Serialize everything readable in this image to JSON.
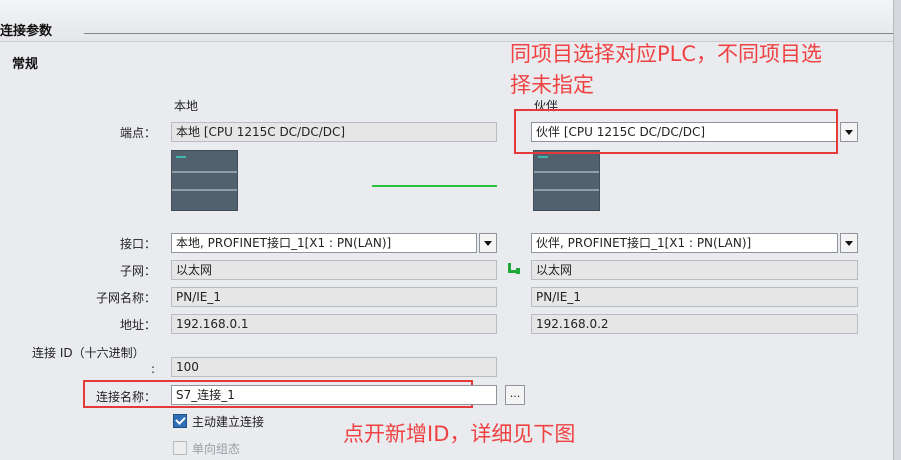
{
  "section": {
    "title": "连接参数"
  },
  "group": {
    "title": "常规"
  },
  "columns": {
    "local": "本地",
    "partner": "伙伴"
  },
  "labels": {
    "endpoint": "端点：",
    "interface": "接口：",
    "subnet": "子网：",
    "subnet_name": "子网名称：",
    "address": "地址：",
    "connection_id_line1": "连接 ID（十六进制）",
    "connection_id_line2": ":",
    "connection_name": "连接名称："
  },
  "local": {
    "endpoint": "本地 [CPU 1215C DC/DC/DC]",
    "interface": "本地, PROFINET接口_1[X1 : PN(LAN)]",
    "subnet": "以太网",
    "subnet_name": "PN/IE_1",
    "address": "192.168.0.1"
  },
  "partner": {
    "endpoint": "伙伴 [CPU 1215C DC/DC/DC]",
    "interface": "伙伴, PROFINET接口_1[X1 : PN(LAN)]",
    "subnet": "以太网",
    "subnet_name": "PN/IE_1",
    "address": "192.168.0.2"
  },
  "connection": {
    "id": "100",
    "name": "S7_连接_1",
    "browse_label": "..."
  },
  "options": {
    "active_connect": {
      "label": "主动建立连接",
      "checked": true
    },
    "one_way": {
      "label": "单向组态",
      "checked": false,
      "enabled": false
    }
  },
  "annotations": {
    "top_line1": "同项目选择对应PLC，不同项目选",
    "top_line2": "择未指定",
    "bottom": "点开新增ID，详细见下图"
  },
  "colors": {
    "annotation": "#f04242",
    "link_line": "#29c23c",
    "checkbox_checked": "#2f6fb5"
  }
}
